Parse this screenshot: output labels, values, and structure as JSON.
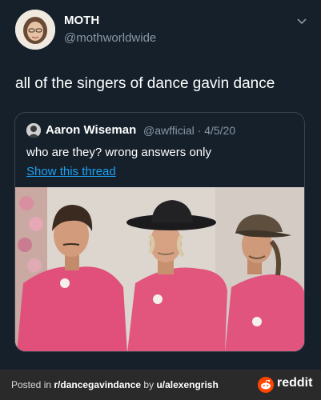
{
  "tweet": {
    "author_name": "MOTH",
    "author_handle": "@mothworldwide",
    "text": "all of the singers of dance gavin dance"
  },
  "quoted_tweet": {
    "author_name": "Aaron Wiseman",
    "meta": "@awfficial · 4/5/20",
    "text": "who are they? wrong answers only",
    "thread_link": "Show this thread"
  },
  "footer": {
    "prefix": "Posted in ",
    "subreddit": "r/dancegavindance",
    "middle": " by ",
    "user": "u/alexengrish",
    "brand": "reddit"
  },
  "colors": {
    "background": "#15202b",
    "link": "#1da1f2",
    "muted": "#8899a6",
    "reddit_orange": "#ff4500"
  },
  "icons": {
    "menu": "chevron-down-icon",
    "brand": "reddit-logo-icon"
  }
}
